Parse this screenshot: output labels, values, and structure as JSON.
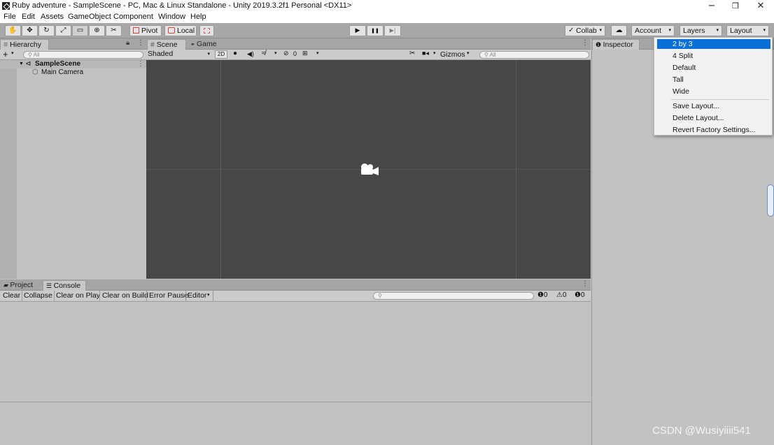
{
  "window": {
    "title": "Ruby adventure - SampleScene - PC, Mac & Linux Standalone - Unity 2019.3.2f1 Personal <DX11>",
    "minimize_glyph": "−",
    "restore_glyph": "❐",
    "close_glyph": "✕"
  },
  "menu": [
    "File",
    "Edit",
    "Assets",
    "GameObject",
    "Component",
    "Window",
    "Help"
  ],
  "toolbar": {
    "tools": [
      "hand-icon",
      "move-icon",
      "rotate-icon",
      "scale-icon",
      "rect-icon",
      "transform-icon",
      "custom-tool-icon"
    ],
    "tool_glyphs": [
      "✋",
      "✥",
      "↻",
      "⤢",
      "▭",
      "⊕",
      "✂"
    ],
    "pivot_label": "Pivot",
    "local_label": "Local",
    "play_glyph": "▶",
    "pause_glyph": "❚❚",
    "step_glyph": "▶|",
    "collab_label": "Collab",
    "cloud_glyph": "☁",
    "account_label": "Account",
    "layers_label": "Layers",
    "layout_label": "Layout",
    "caret_glyph": "▾"
  },
  "hierarchy": {
    "tab_label": "Hierarchy",
    "add_glyph": "+",
    "search_placeholder": "All",
    "scene_name": "SampleScene",
    "items": [
      "Main Camera"
    ]
  },
  "scene_panel": {
    "tabs": [
      "Scene",
      "Game"
    ],
    "shading_mode": "Shaded",
    "mode_2d": "2D",
    "hidden_count": "0",
    "gizmos_label": "Gizmos",
    "search_placeholder": "All"
  },
  "console_panel": {
    "tabs": [
      "Project",
      "Console"
    ],
    "buttons": [
      "Clear",
      "Collapse",
      "Clear on Play",
      "Clear on Build",
      "Error Pause",
      "Editor"
    ],
    "info_count": "0",
    "warning_count": "0",
    "error_count": "0"
  },
  "inspector": {
    "tab_label": "Inspector"
  },
  "layout_menu": {
    "items": [
      "2 by 3",
      "4 Split",
      "Default",
      "Tall",
      "Wide"
    ],
    "actions": [
      "Save Layout...",
      "Delete Layout...",
      "Revert Factory Settings..."
    ],
    "selected": "2 by 3"
  },
  "watermark": "CSDN @Wusiyiiii541",
  "colors": {
    "scene_background": "#474747",
    "selection": "#0a6fd6",
    "panel": "#c2c2c2",
    "toolbar": "#a8a8a8"
  }
}
